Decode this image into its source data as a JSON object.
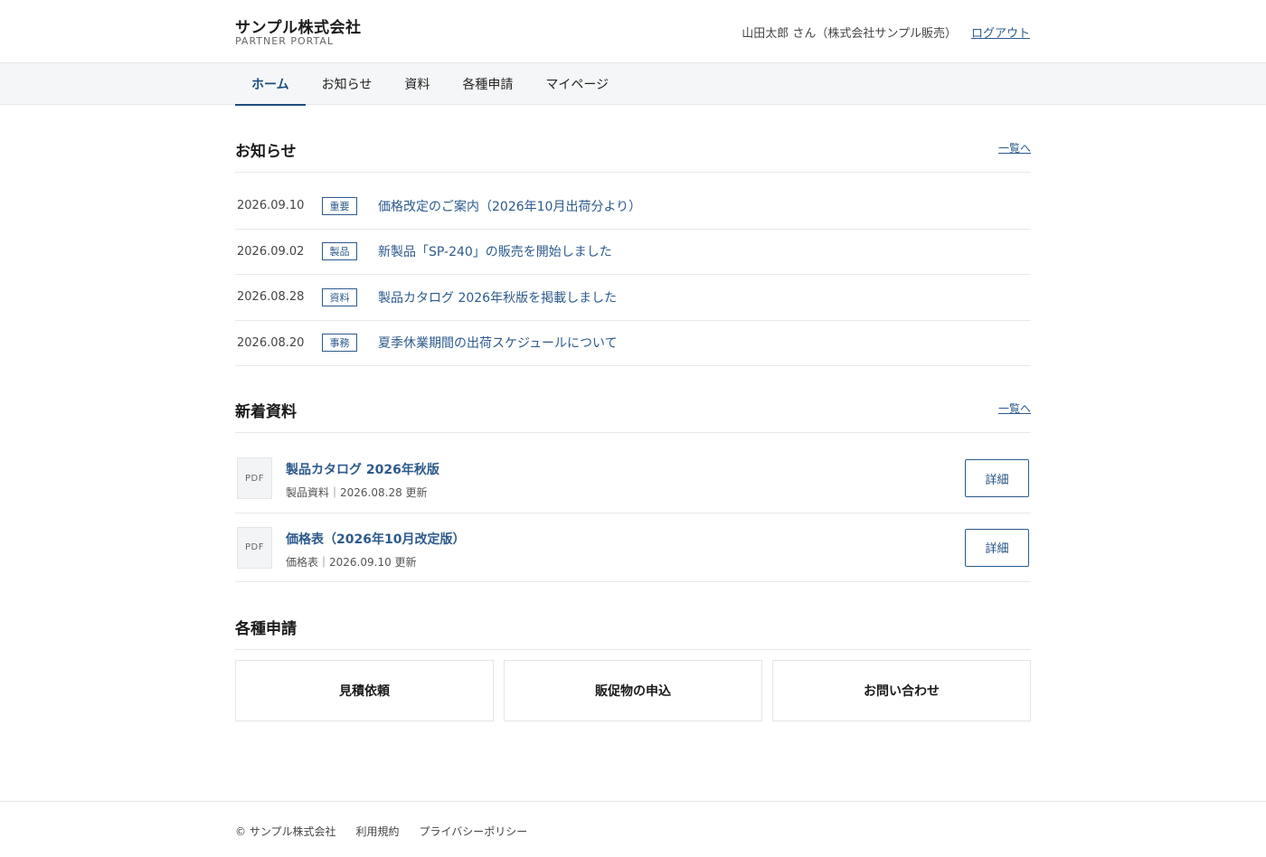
{
  "header": {
    "brand_name": "サンプル株式会社",
    "brand_sub": "PARTNER PORTAL",
    "user_info": "山田太郎 さん（株式会社サンプル販売）",
    "logout_label": "ログアウト"
  },
  "nav": {
    "items": [
      {
        "label": "ホーム",
        "active": true
      },
      {
        "label": "お知らせ",
        "active": false
      },
      {
        "label": "資料",
        "active": false
      },
      {
        "label": "各種申請",
        "active": false
      },
      {
        "label": "マイページ",
        "active": false
      }
    ]
  },
  "news": {
    "title": "お知らせ",
    "more_label": "一覧へ",
    "items": [
      {
        "date": "2026.09.10",
        "tag": "重要",
        "title": "価格改定のご案内（2026年10月出荷分より）"
      },
      {
        "date": "2026.09.02",
        "tag": "製品",
        "title": "新製品「SP-240」の販売を開始しました"
      },
      {
        "date": "2026.08.28",
        "tag": "資料",
        "title": "製品カタログ 2026年秋版を掲載しました"
      },
      {
        "date": "2026.08.20",
        "tag": "事務",
        "title": "夏季休業期間の出荷スケジュールについて"
      }
    ]
  },
  "docs": {
    "title": "新着資料",
    "more_label": "一覧へ",
    "items": [
      {
        "icon_label": "PDF",
        "title": "製品カタログ 2026年秋版",
        "meta": "製品資料｜2026.08.28 更新",
        "button_label": "詳細"
      },
      {
        "icon_label": "PDF",
        "title": "価格表（2026年10月改定版）",
        "meta": "価格表｜2026.09.10 更新",
        "button_label": "詳細"
      }
    ]
  },
  "applications": {
    "title": "各種申請",
    "items": [
      {
        "label": "見積依頼"
      },
      {
        "label": "販促物の申込"
      },
      {
        "label": "お問い合わせ"
      }
    ]
  },
  "footer": {
    "copyright": "© サンプル株式会社",
    "links": [
      "利用規約",
      "プライバシーポリシー"
    ]
  },
  "colors": {
    "accent": "#2c5a8c",
    "nav_active": "#1f4e80",
    "nav_bg": "#f5f6f7",
    "border": "#e6e8ea"
  }
}
